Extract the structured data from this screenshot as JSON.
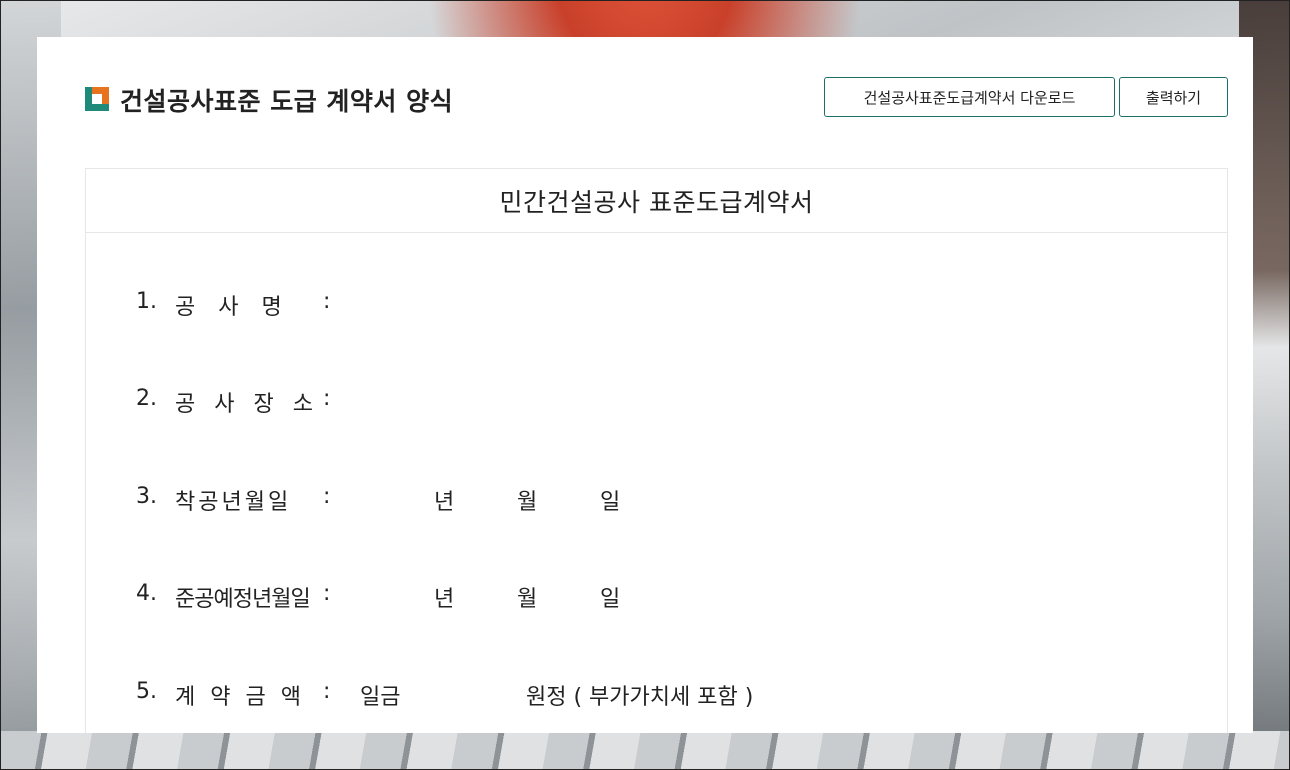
{
  "header": {
    "title": "건설공사표준 도급 계약서 양식",
    "download_label": "건설공사표준도급계약서 다운로드",
    "print_label": "출력하기",
    "icon": "square-logo-icon",
    "accent_colors": {
      "orange": "#e8731f",
      "teal": "#1f8a7a",
      "button_border": "#1e6f6a"
    }
  },
  "document": {
    "title": "민간건설공사 표준도급계약서",
    "items": [
      {
        "number": "1.",
        "label": "공  사  명",
        "colon": ":"
      },
      {
        "number": "2.",
        "label": "공 사 장 소",
        "colon": ":"
      },
      {
        "number": "3.",
        "label": "착공년월일",
        "colon": ":",
        "year": "년",
        "month": "월",
        "day": "일"
      },
      {
        "number": "4.",
        "label": "준공예정년월일",
        "colon": ":",
        "year": "년",
        "month": "월",
        "day": "일"
      },
      {
        "number": "5.",
        "label": "계  약  금  액",
        "colon": ":",
        "amount_prefix": "일금",
        "amount_suffix": "원정 ( 부가가치세 포함 )"
      }
    ]
  }
}
